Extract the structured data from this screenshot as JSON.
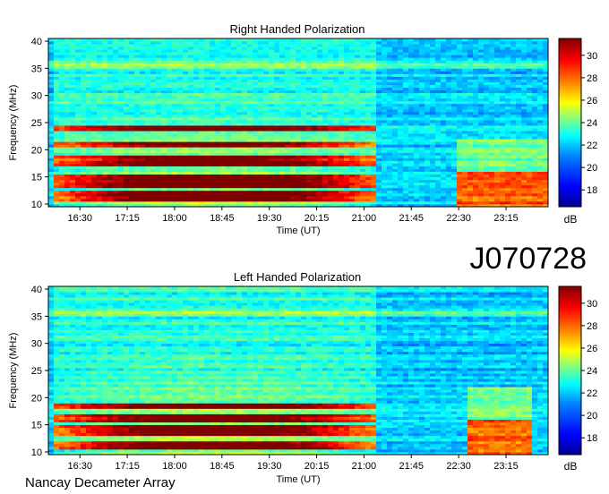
{
  "figure_id": "J070728",
  "footer": "Nancay Decameter Array",
  "colors": {
    "colormap": [
      "#00008f",
      "#0000ff",
      "#0080ff",
      "#00ffff",
      "#80ff80",
      "#ffff00",
      "#ff8000",
      "#ff0000",
      "#800000"
    ],
    "frame": "#000000"
  },
  "chart_data": [
    {
      "type": "heatmap",
      "title": "Right Handed Polarization",
      "xlabel": "Time (UT)",
      "ylabel": "Frequency (MHz)",
      "x_ticks": [
        "16:30",
        "17:15",
        "18:00",
        "18:45",
        "19:30",
        "20:15",
        "21:00",
        "21:45",
        "22:30",
        "23:15"
      ],
      "y_ticks": [
        10,
        15,
        20,
        25,
        30,
        35,
        40
      ],
      "ylim": [
        9.5,
        40.5
      ],
      "xlim": [
        "16:00",
        "23:55"
      ],
      "colorbar": {
        "label": "dB",
        "ticks": [
          18,
          20,
          22,
          24,
          26,
          28,
          30
        ],
        "range": [
          16.5,
          31.5
        ]
      },
      "features": {
        "intense_bands_MHz": [
          [
            10.5,
            12.5
          ],
          [
            13,
            15.5
          ],
          [
            17,
            19
          ],
          [
            20.5,
            21.5
          ],
          [
            23.5,
            24.5
          ]
        ],
        "activity_window_UT": [
          "16:05",
          "21:10"
        ],
        "late_emission_UT": [
          "22:30",
          "23:55"
        ]
      }
    },
    {
      "type": "heatmap",
      "title": "Left Handed Polarization",
      "xlabel": "Time (UT)",
      "ylabel": "Frequency (MHz)",
      "x_ticks": [
        "16:30",
        "17:15",
        "18:00",
        "18:45",
        "19:30",
        "20:15",
        "21:00",
        "21:45",
        "22:30",
        "23:15"
      ],
      "y_ticks": [
        10,
        15,
        20,
        25,
        30,
        35,
        40
      ],
      "ylim": [
        9.5,
        40.5
      ],
      "xlim": [
        "16:00",
        "23:55"
      ],
      "colorbar": {
        "label": "dB",
        "ticks": [
          18,
          20,
          22,
          24,
          26,
          28,
          30
        ],
        "range": [
          16.5,
          31.5
        ]
      },
      "features": {
        "intense_bands_MHz": [
          [
            10.5,
            12
          ],
          [
            13,
            15
          ],
          [
            15.5,
            17
          ],
          [
            18,
            19
          ]
        ],
        "activity_window_UT": [
          "16:05",
          "21:10"
        ],
        "late_emission_UT": [
          "22:40",
          "23:40"
        ]
      }
    }
  ]
}
